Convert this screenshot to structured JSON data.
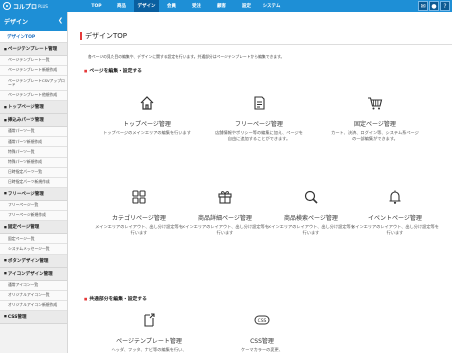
{
  "app": {
    "logo_text": "コルプロ",
    "logo_suffix": "PLUS"
  },
  "nav": [
    "TOP",
    "商品",
    "デザイン",
    "会員",
    "受注",
    "顧客",
    "設定",
    "システム"
  ],
  "nav_active_index": 2,
  "sidebar": {
    "header": "デザイン",
    "top_link": "デザインTOP",
    "groups": [
      {
        "label": "ページテンプレート管理",
        "items": [
          "ページテンプレート一覧",
          "ページテンプレート新規作成",
          "ページテンプレートCSVアップロード",
          "ページテンプレート他規作成"
        ]
      },
      {
        "label": "トップページ管理",
        "items": []
      },
      {
        "label": "挿込みパーツ管理",
        "items": [
          "通常パーツ一覧",
          "通常パーツ新規作成",
          "特殊パーツ一覧",
          "特殊パーツ新規作成",
          "日時指定パーツ一覧",
          "日時指定パーツ新規作成"
        ]
      },
      {
        "label": "フリーページ管理",
        "items": [
          "フリーページ一覧",
          "フリーページ新規作成"
        ]
      },
      {
        "label": "固定ページ管理",
        "items": [
          "固定ページ一覧",
          "システムメッセージ一覧"
        ]
      },
      {
        "label": "ボタンデザイン管理",
        "items": []
      },
      {
        "label": "アイコンデザイン管理",
        "items": [
          "通常アイコン一覧",
          "オリジナルアイコン一覧",
          "オリジナルアイコン新規作成"
        ]
      },
      {
        "label": "CSS管理",
        "items": []
      }
    ]
  },
  "main": {
    "title": "デザインTOP",
    "description": "各ページの見た目の編集や、デザインに関する設定を行います。共通部分はページテンプレートから編集できます。",
    "section1": "ページを編集・設定する",
    "section2": "共通部分を編集・設定する",
    "cards": [
      {
        "icon": "home-icon",
        "title": "トップページ管理",
        "desc": "トップページのメインエリアの編集を行います"
      },
      {
        "icon": "document-icon",
        "title": "フリーページ管理",
        "desc": "店舗情報やポリシー等の編集に加え、ページを自由に追加することができます。"
      },
      {
        "icon": "cart-icon",
        "title": "固定ページ管理",
        "desc": "カート、決済、ログイン等、システム系ページの一部編集ができます。"
      },
      {
        "icon": "grid-icon",
        "title": "カテゴリページ管理",
        "desc": "メインエリアのレイアウト、出し分け設定等を行います"
      },
      {
        "icon": "gift-icon",
        "title": "商品詳細ページ管理",
        "desc": "メインエリアのレイアウト、出し分け設定等を行います"
      },
      {
        "icon": "search-icon",
        "title": "商品検索ページ管理",
        "desc": "メインエリアのレイアウト、出し分け設定等を行います"
      },
      {
        "icon": "bell-icon",
        "title": "イベントページ管理",
        "desc": "メインエリアのレイアウト、出し分け設定等を行います"
      },
      {
        "icon": "template-icon",
        "title": "ページテンプレート管理",
        "desc": "ヘッダ、フッタ、ナビ等の編集を行い、"
      },
      {
        "icon": "css-icon",
        "title": "CSS管理",
        "desc": "ケーマカラーの変更、"
      }
    ]
  },
  "colors": {
    "accent": "#1e8fd6",
    "nav_active": "#0a5fa0",
    "section_marker": "#e63a3a"
  }
}
